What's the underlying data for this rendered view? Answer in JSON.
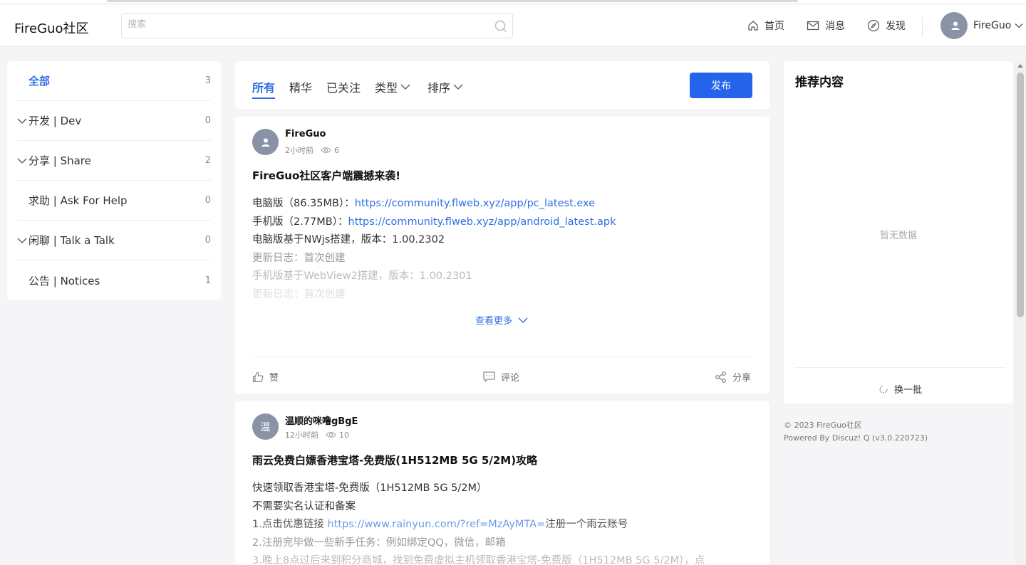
{
  "header": {
    "logo": "FireGuo社区",
    "search_placeholder": "搜索",
    "nav": [
      {
        "label": "首页",
        "icon": "home-icon"
      },
      {
        "label": "消息",
        "icon": "mail-icon"
      },
      {
        "label": "发现",
        "icon": "compass-icon"
      }
    ],
    "user_name": "FireGuo"
  },
  "sidebar": {
    "categories": [
      {
        "label": "全部",
        "count": "3",
        "expandable": false,
        "active": true
      },
      {
        "label": "开发 | Dev",
        "count": "0",
        "expandable": true
      },
      {
        "label": "分享 | Share",
        "count": "2",
        "expandable": true
      },
      {
        "label": "求助 | Ask For Help",
        "count": "0",
        "expandable": false
      },
      {
        "label": "闲聊 | Talk a Talk",
        "count": "0",
        "expandable": true
      },
      {
        "label": "公告 | Notices",
        "count": "1",
        "expandable": false
      }
    ]
  },
  "tabs": {
    "items": [
      "所有",
      "精华",
      "已关注",
      "类型",
      "排序"
    ],
    "active": "所有",
    "publish_label": "发布"
  },
  "posts": [
    {
      "avatar_text": "",
      "author": "FireGuo",
      "time": "2小时前",
      "views": "6",
      "title": "FireGuo社区客户端震撼来袭!",
      "lines": [
        {
          "prefix": "电脑版（86.35MB）：",
          "link": "https://community.flweb.xyz/app/pc_latest.exe",
          "suffix": ""
        },
        {
          "prefix": "手机版（2.77MB）：",
          "link": "https://community.flweb.xyz/app/android_latest.apk",
          "suffix": ""
        },
        {
          "prefix": "电脑版基于NWjs搭建，版本：1.00.2302",
          "link": "",
          "suffix": ""
        },
        {
          "prefix": "更新日志：首次创建",
          "link": "",
          "suffix": ""
        },
        {
          "prefix": "手机版基于WebView2搭建，版本：1.00.2301",
          "link": "",
          "suffix": ""
        },
        {
          "prefix": "更新日志：首次创建",
          "link": "",
          "suffix": ""
        }
      ],
      "more_label": "查看更多",
      "actions": {
        "like": "赞",
        "comment": "评论",
        "share": "分享"
      }
    },
    {
      "avatar_text": "温",
      "author": "温顺的咪噜gBgE",
      "time": "12小时前",
      "views": "10",
      "title": "雨云免费白嫖香港宝塔-免费版(1H512MB 5G 5/2M)攻略",
      "lines": [
        {
          "prefix": "快速领取香港宝塔-免费版（1H512MB 5G 5/2M）",
          "link": "",
          "suffix": ""
        },
        {
          "prefix": "不需要实名认证和备案",
          "link": "",
          "suffix": ""
        },
        {
          "prefix": "1.点击优惠链接 ",
          "link": "https://www.rainyun.com/?ref=MzAyMTA=",
          "suffix": "注册一个雨云账号"
        },
        {
          "prefix": "2.注册完毕做一些新手任务：例如绑定QQ，微信，邮箱",
          "link": "",
          "suffix": ""
        },
        {
          "prefix": "3.晚上8点过后来到积分商城，找到免费虚拟主机领取香港宝塔-免费版（1H512MB 5G 5/2M），点",
          "link": "",
          "suffix": ""
        }
      ]
    }
  ],
  "recommend": {
    "title": "推荐内容",
    "empty": "暂无数据",
    "refresh": "换一批"
  },
  "footer": {
    "copyright": "© 2023 FireGuo社区",
    "powered": "Powered By Discuz! Q (v3.0.220723)"
  }
}
